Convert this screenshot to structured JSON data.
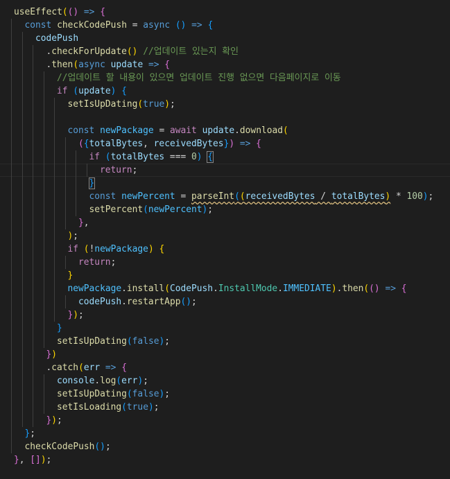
{
  "theme": {
    "background": "#1e1e1e",
    "colors": {
      "kw": "#569cd6",
      "ctrl": "#c586c0",
      "fn": "#dcdcaa",
      "var": "#9cdcfe",
      "const": "#4fc1ff",
      "type": "#4ec9b0",
      "num": "#b5cea8",
      "comment": "#6a9955",
      "plain": "#d4d4d4",
      "b1": "#ffd700",
      "b2": "#da70d6",
      "b3": "#179fff"
    }
  },
  "code_lines": [
    {
      "indent": 0,
      "tokens": [
        [
          "useEffect",
          "fn"
        ],
        [
          "(",
          "b1"
        ],
        [
          "()",
          "b2"
        ],
        [
          " ",
          "plain"
        ],
        [
          "=>",
          "kw"
        ],
        [
          " ",
          "plain"
        ],
        [
          "{",
          "b2"
        ]
      ]
    },
    {
      "indent": 1,
      "tokens": [
        [
          "const",
          "kw"
        ],
        [
          " ",
          "plain"
        ],
        [
          "checkCodePush",
          "fn"
        ],
        [
          " = ",
          "plain"
        ],
        [
          "async",
          "kw"
        ],
        [
          " ",
          "plain"
        ],
        [
          "()",
          "b3"
        ],
        [
          " ",
          "plain"
        ],
        [
          "=>",
          "kw"
        ],
        [
          " ",
          "plain"
        ],
        [
          "{",
          "b3"
        ]
      ]
    },
    {
      "indent": 2,
      "tokens": [
        [
          "codePush",
          "var"
        ]
      ]
    },
    {
      "indent": 3,
      "tokens": [
        [
          ".",
          "plain"
        ],
        [
          "checkForUpdate",
          "fn"
        ],
        [
          "()",
          "b1"
        ],
        [
          " ",
          "plain"
        ],
        [
          "//업데이트 있는지 확인",
          "comment"
        ]
      ]
    },
    {
      "indent": 3,
      "tokens": [
        [
          ".",
          "plain"
        ],
        [
          "then",
          "fn"
        ],
        [
          "(",
          "b1"
        ],
        [
          "async",
          "kw"
        ],
        [
          " ",
          "plain"
        ],
        [
          "update",
          "var"
        ],
        [
          " ",
          "plain"
        ],
        [
          "=>",
          "kw"
        ],
        [
          " ",
          "plain"
        ],
        [
          "{",
          "b2"
        ]
      ]
    },
    {
      "indent": 4,
      "tokens": [
        [
          "//업데이트 할 내용이 있으면 업데이트 진행 없으면 다음페이지로 이동",
          "comment"
        ]
      ]
    },
    {
      "indent": 4,
      "tokens": [
        [
          "if",
          "ctrl"
        ],
        [
          " ",
          "plain"
        ],
        [
          "(",
          "b3"
        ],
        [
          "update",
          "var"
        ],
        [
          ")",
          "b3"
        ],
        [
          " ",
          "plain"
        ],
        [
          "{",
          "b3"
        ]
      ]
    },
    {
      "indent": 5,
      "tokens": [
        [
          "setIsUpDating",
          "fn"
        ],
        [
          "(",
          "b1"
        ],
        [
          "true",
          "kw"
        ],
        [
          ")",
          "b1"
        ],
        [
          ";",
          "plain"
        ]
      ]
    },
    {
      "indent": 5,
      "tokens": []
    },
    {
      "indent": 5,
      "tokens": [
        [
          "const",
          "kw"
        ],
        [
          " ",
          "plain"
        ],
        [
          "newPackage",
          "const"
        ],
        [
          " = ",
          "plain"
        ],
        [
          "await",
          "ctrl"
        ],
        [
          " ",
          "plain"
        ],
        [
          "update",
          "var"
        ],
        [
          ".",
          "plain"
        ],
        [
          "download",
          "fn"
        ],
        [
          "(",
          "b1"
        ]
      ]
    },
    {
      "indent": 6,
      "tokens": [
        [
          "(",
          "b2"
        ],
        [
          "{",
          "b3"
        ],
        [
          "totalBytes",
          "var"
        ],
        [
          ", ",
          "plain"
        ],
        [
          "receivedBytes",
          "var"
        ],
        [
          "}",
          "b3"
        ],
        [
          ")",
          "b2"
        ],
        [
          " ",
          "plain"
        ],
        [
          "=>",
          "kw"
        ],
        [
          " ",
          "plain"
        ],
        [
          "{",
          "b2"
        ]
      ]
    },
    {
      "indent": 7,
      "tokens": [
        [
          "if",
          "ctrl"
        ],
        [
          " ",
          "plain"
        ],
        [
          "(",
          "b3"
        ],
        [
          "totalBytes",
          "var"
        ],
        [
          " === ",
          "plain"
        ],
        [
          "0",
          "num"
        ],
        [
          ")",
          "b3"
        ],
        [
          " ",
          "plain"
        ],
        [
          "{",
          "b3",
          "match"
        ]
      ]
    },
    {
      "indent": 8,
      "tokens": [
        [
          "return",
          "ctrl"
        ],
        [
          ";",
          "plain"
        ]
      ]
    },
    {
      "indent": 7,
      "tokens": [
        [
          "}",
          "b3",
          "match"
        ]
      ]
    },
    {
      "indent": 7,
      "tokens": [
        [
          "const",
          "kw"
        ],
        [
          " ",
          "plain"
        ],
        [
          "newPercent",
          "const"
        ],
        [
          " = ",
          "plain"
        ],
        [
          "parseInt",
          "fn",
          "sq"
        ],
        [
          "(",
          "b3",
          "sq"
        ],
        [
          "(",
          "b1",
          "sq"
        ],
        [
          "receivedBytes",
          "var",
          "sq"
        ],
        [
          " / ",
          "plain",
          "sq"
        ],
        [
          "totalBytes",
          "var",
          "sq"
        ],
        [
          ")",
          "b1",
          "sq"
        ],
        [
          " * ",
          "plain"
        ],
        [
          "100",
          "num"
        ],
        [
          ")",
          "b3"
        ],
        [
          ";",
          "plain"
        ]
      ]
    },
    {
      "indent": 7,
      "tokens": [
        [
          "setPercent",
          "fn"
        ],
        [
          "(",
          "b3"
        ],
        [
          "newPercent",
          "const"
        ],
        [
          ")",
          "b3"
        ],
        [
          ";",
          "plain"
        ]
      ]
    },
    {
      "indent": 6,
      "tokens": [
        [
          "}",
          "b2"
        ],
        [
          ",",
          "plain"
        ]
      ]
    },
    {
      "indent": 5,
      "tokens": [
        [
          ")",
          "b1"
        ],
        [
          ";",
          "plain"
        ]
      ]
    },
    {
      "indent": 5,
      "tokens": [
        [
          "if",
          "ctrl"
        ],
        [
          " ",
          "plain"
        ],
        [
          "(",
          "b1"
        ],
        [
          "!",
          "plain"
        ],
        [
          "newPackage",
          "const"
        ],
        [
          ")",
          "b1"
        ],
        [
          " ",
          "plain"
        ],
        [
          "{",
          "b1"
        ]
      ]
    },
    {
      "indent": 6,
      "tokens": [
        [
          "return",
          "ctrl"
        ],
        [
          ";",
          "plain"
        ]
      ]
    },
    {
      "indent": 5,
      "tokens": [
        [
          "}",
          "b1"
        ]
      ]
    },
    {
      "indent": 5,
      "tokens": [
        [
          "newPackage",
          "const"
        ],
        [
          ".",
          "plain"
        ],
        [
          "install",
          "fn"
        ],
        [
          "(",
          "b1"
        ],
        [
          "CodePush",
          "var"
        ],
        [
          ".",
          "plain"
        ],
        [
          "InstallMode",
          "type"
        ],
        [
          ".",
          "plain"
        ],
        [
          "IMMEDIATE",
          "const"
        ],
        [
          ")",
          "b1"
        ],
        [
          ".",
          "plain"
        ],
        [
          "then",
          "fn"
        ],
        [
          "(",
          "b1"
        ],
        [
          "()",
          "b2"
        ],
        [
          " ",
          "plain"
        ],
        [
          "=>",
          "kw"
        ],
        [
          " ",
          "plain"
        ],
        [
          "{",
          "b2"
        ]
      ]
    },
    {
      "indent": 6,
      "tokens": [
        [
          "codePush",
          "var"
        ],
        [
          ".",
          "plain"
        ],
        [
          "restartApp",
          "fn"
        ],
        [
          "()",
          "b3"
        ],
        [
          ";",
          "plain"
        ]
      ]
    },
    {
      "indent": 5,
      "tokens": [
        [
          "}",
          "b2"
        ],
        [
          ")",
          "b1"
        ],
        [
          ";",
          "plain"
        ]
      ]
    },
    {
      "indent": 4,
      "tokens": [
        [
          "}",
          "b3"
        ]
      ]
    },
    {
      "indent": 4,
      "tokens": [
        [
          "setIsUpDating",
          "fn"
        ],
        [
          "(",
          "b3"
        ],
        [
          "false",
          "kw"
        ],
        [
          ")",
          "b3"
        ],
        [
          ";",
          "plain"
        ]
      ]
    },
    {
      "indent": 3,
      "tokens": [
        [
          "}",
          "b2"
        ],
        [
          ")",
          "b1"
        ]
      ]
    },
    {
      "indent": 3,
      "tokens": [
        [
          ".",
          "plain"
        ],
        [
          "catch",
          "fn"
        ],
        [
          "(",
          "b1"
        ],
        [
          "err",
          "var"
        ],
        [
          " ",
          "plain"
        ],
        [
          "=>",
          "kw"
        ],
        [
          " ",
          "plain"
        ],
        [
          "{",
          "b2"
        ]
      ]
    },
    {
      "indent": 4,
      "tokens": [
        [
          "console",
          "var"
        ],
        [
          ".",
          "plain"
        ],
        [
          "log",
          "fn"
        ],
        [
          "(",
          "b3"
        ],
        [
          "err",
          "var"
        ],
        [
          ")",
          "b3"
        ],
        [
          ";",
          "plain"
        ]
      ]
    },
    {
      "indent": 4,
      "tokens": [
        [
          "setIsUpDating",
          "fn"
        ],
        [
          "(",
          "b3"
        ],
        [
          "false",
          "kw"
        ],
        [
          ")",
          "b3"
        ],
        [
          ";",
          "plain"
        ]
      ]
    },
    {
      "indent": 4,
      "tokens": [
        [
          "setIsLoading",
          "fn"
        ],
        [
          "(",
          "b3"
        ],
        [
          "true",
          "kw"
        ],
        [
          ")",
          "b3"
        ],
        [
          ";",
          "plain"
        ]
      ]
    },
    {
      "indent": 3,
      "tokens": [
        [
          "}",
          "b2"
        ],
        [
          ")",
          "b1"
        ],
        [
          ";",
          "plain"
        ]
      ]
    },
    {
      "indent": 1,
      "tokens": [
        [
          "}",
          "b3"
        ],
        [
          ";",
          "plain"
        ]
      ]
    },
    {
      "indent": 1,
      "tokens": [
        [
          "checkCodePush",
          "fn"
        ],
        [
          "()",
          "b3"
        ],
        [
          ";",
          "plain"
        ]
      ]
    },
    {
      "indent": 0,
      "tokens": [
        [
          "}",
          "b2"
        ],
        [
          ", ",
          "plain"
        ],
        [
          "[]",
          "b2"
        ],
        [
          ")",
          "b1"
        ],
        [
          ";",
          "plain"
        ]
      ]
    }
  ]
}
